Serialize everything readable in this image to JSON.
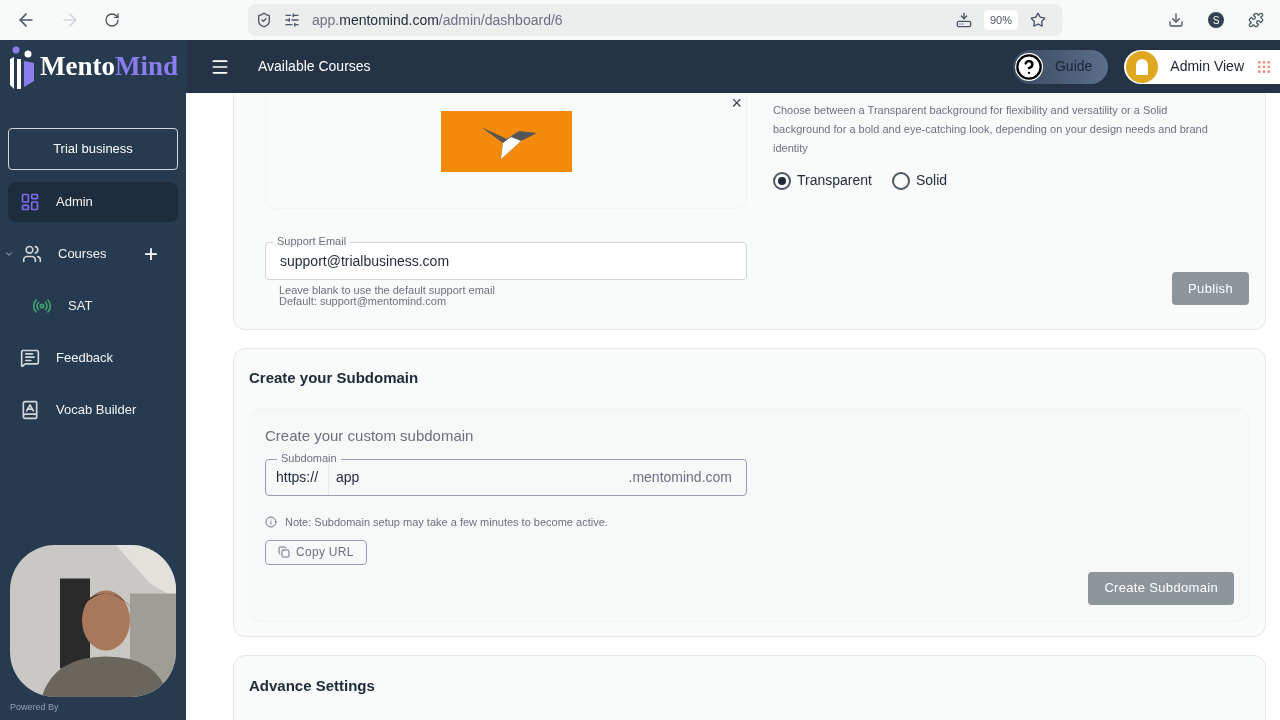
{
  "browser": {
    "url": "app.**mentomind.com**/admin/dashboard/6",
    "zoom": "90%",
    "profile": "S",
    "forward_disabled": true
  },
  "brand": {
    "first": "Mento",
    "second": "Mind"
  },
  "header": {
    "title": "Available Courses",
    "guide": "Guide",
    "user": "Admin View"
  },
  "sidebar": {
    "business": "Trial business",
    "items": [
      {
        "label": "Admin",
        "kind": "admin",
        "selected": true
      },
      {
        "label": "Courses",
        "kind": "courses",
        "selected": false,
        "expanded": true,
        "add": "+",
        "children": [
          {
            "label": "SAT",
            "kind": "sat",
            "selected": false
          }
        ]
      },
      {
        "label": "Feedback",
        "kind": "feedback",
        "selected": false
      },
      {
        "label": "Vocab Builder",
        "kind": "vocab",
        "selected": false
      }
    ],
    "powered": "Powered By"
  },
  "branding_card": {
    "close": "×",
    "description": "Choose between a Transparent background for flexibility and versatility or a Solid background for a bold and eye-catching look, depending on your design needs and brand identity",
    "options": [
      {
        "label": "Transparent",
        "selected": true
      },
      {
        "label": "Solid",
        "selected": false
      }
    ],
    "email": {
      "label": "Support Email",
      "value": "support@trialbusiness.com",
      "help": [
        "Leave blank to use the default support email",
        "Default: support@mentomind.com"
      ]
    },
    "publish": {
      "label": "Publish",
      "disabled": true
    }
  },
  "subdomain_card": {
    "title": "Create your Subdomain",
    "subtitle": "Create your custom subdomain",
    "field": {
      "label": "Subdomain",
      "prefix": "https://",
      "value": "app",
      "suffix": ".mentomind.com"
    },
    "note": "Note: Subdomain setup may take a few minutes to become active.",
    "copy": "Copy URL",
    "create": {
      "label": "Create Subdomain",
      "disabled": true
    }
  },
  "advance_card": {
    "title": "Advance Settings"
  }
}
